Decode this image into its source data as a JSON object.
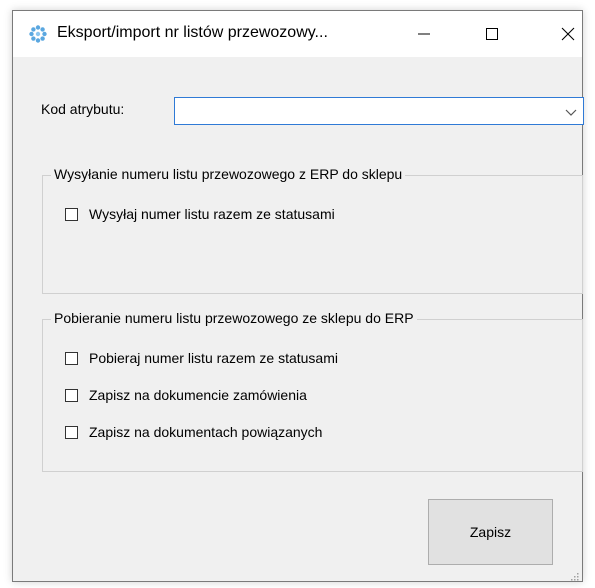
{
  "window": {
    "title": "Eksport/import nr listów przewozowy...",
    "icon": "gear-flower-icon",
    "controls": {
      "minimize_icon": "minimize-icon",
      "maximize_icon": "maximize-icon",
      "close_icon": "close-icon"
    }
  },
  "form": {
    "kod_label": "Kod atrybutu:",
    "kod_value": ""
  },
  "group_send": {
    "legend": "Wysyłanie numeru listu przewozowego z ERP do sklepu",
    "options": [
      {
        "label": "Wysyłaj numer listu razem ze statusami",
        "checked": false
      }
    ]
  },
  "group_fetch": {
    "legend": "Pobieranie numeru listu przewozowego ze sklepu do ERP",
    "options": [
      {
        "label": "Pobieraj numer listu razem ze statusami",
        "checked": false
      },
      {
        "label": "Zapisz na dokumencie zamówienia",
        "checked": false
      },
      {
        "label": "Zapisz na dokumentach powiązanych",
        "checked": false
      }
    ]
  },
  "actions": {
    "save_label": "Zapisz"
  },
  "colors": {
    "focus_border": "#2f7ad6",
    "window_bg": "#f0f0f0",
    "button_bg": "#e1e1e1"
  }
}
